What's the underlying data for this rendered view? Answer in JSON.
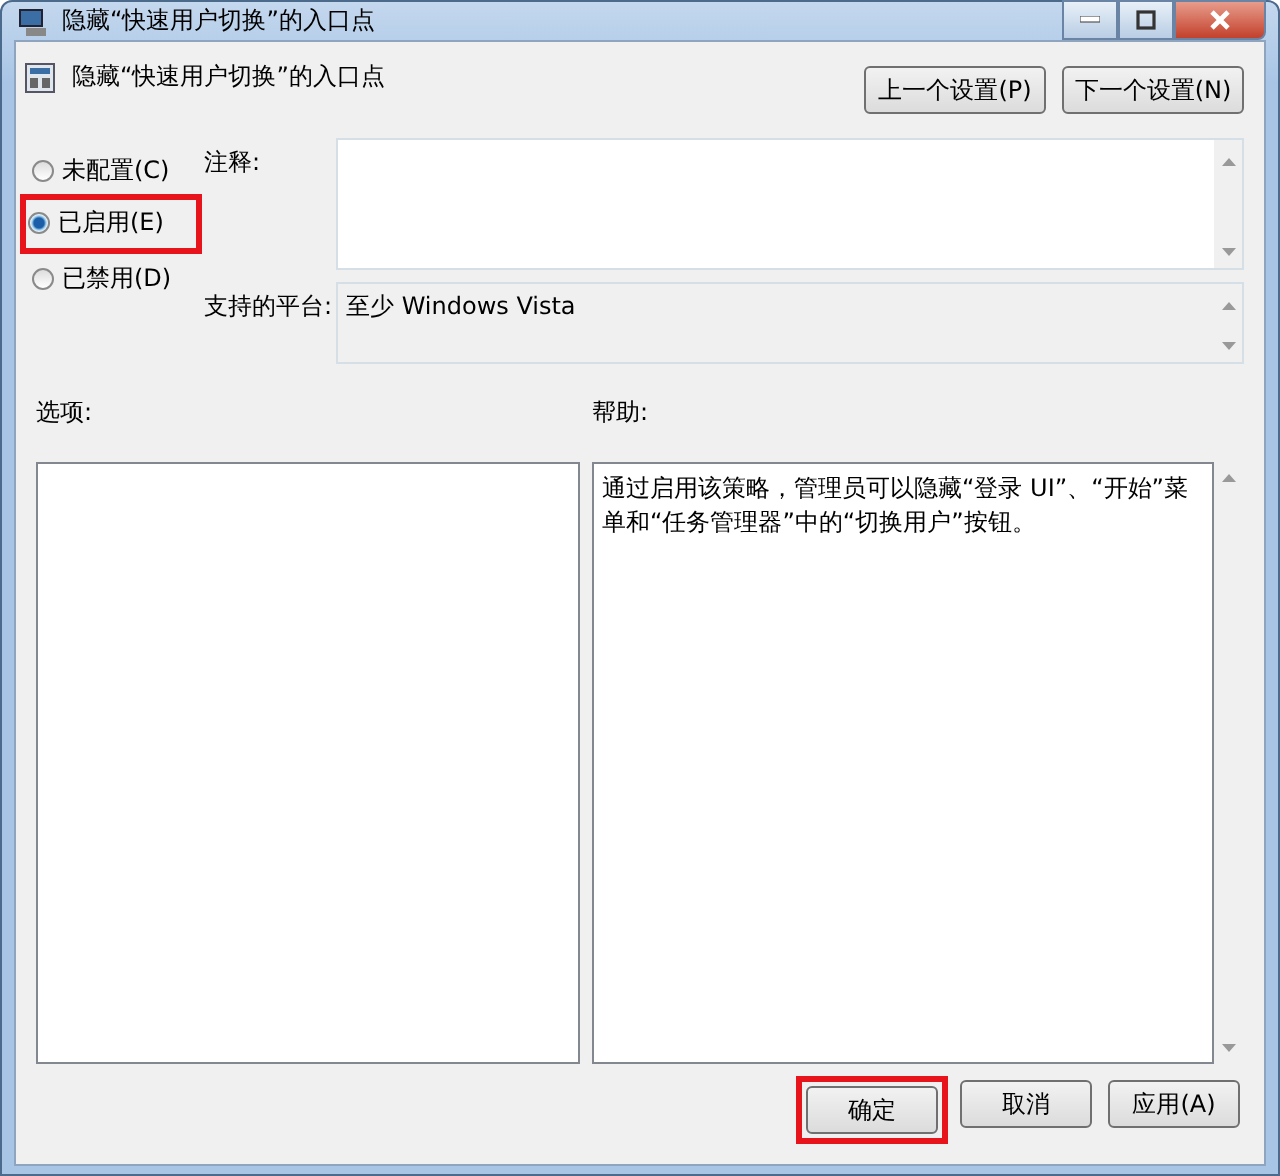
{
  "window": {
    "title": "隐藏“快速用户切换”的入口点"
  },
  "policy": {
    "title": "隐藏“快速用户切换”的入口点",
    "nav_buttons": [
      "上一个设置(P)",
      "下一个设置(N)"
    ]
  },
  "state_options": [
    {
      "label": "未配置(C)",
      "selected": false,
      "highlighted": false
    },
    {
      "label": "已启用(E)",
      "selected": true,
      "highlighted": true
    },
    {
      "label": "已禁用(D)",
      "selected": false,
      "highlighted": false
    }
  ],
  "comment": {
    "label": "注释:"
  },
  "platform": {
    "label": "支持的平台:",
    "value": "至少 Windows Vista"
  },
  "options": {
    "label": "选项:"
  },
  "help": {
    "label": "帮助:",
    "text": "通过启用该策略，管理员可以隐藏“登录 UI”、“开始”菜单和“任务管理器”中的“切换用户”按钮。"
  },
  "footer_buttons": [
    {
      "label": "确定",
      "highlighted": true
    },
    {
      "label": "取消",
      "highlighted": false
    },
    {
      "label": "应用(A)",
      "highlighted": false
    }
  ]
}
